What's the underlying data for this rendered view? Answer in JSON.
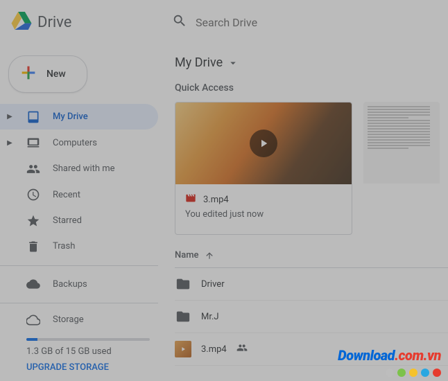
{
  "header": {
    "product_name": "Drive",
    "search_placeholder": "Search Drive"
  },
  "new_button": {
    "label": "New"
  },
  "nav": {
    "my_drive": "My Drive",
    "computers": "Computers",
    "shared": "Shared with me",
    "recent": "Recent",
    "starred": "Starred",
    "trash": "Trash",
    "backups": "Backups",
    "storage": "Storage"
  },
  "storage": {
    "used_text": "1.3 GB of 15 GB used",
    "upgrade": "UPGRADE STORAGE"
  },
  "main": {
    "breadcrumb": "My Drive",
    "quick_access_label": "Quick Access",
    "list_header_name": "Name"
  },
  "quick_access": {
    "primary": {
      "title": "3.mp4",
      "subtitle": "You edited just now"
    }
  },
  "files": [
    {
      "name": "Driver",
      "type": "folder"
    },
    {
      "name": "Mr.J",
      "type": "folder"
    },
    {
      "name": "3.mp4",
      "type": "video",
      "shared": true
    }
  ],
  "watermark": {
    "brand": "Download",
    "tld": ".com.vn",
    "dot_colors": [
      "#bdbdbd",
      "#7cc24a",
      "#f5c22b",
      "#29a7e1",
      "#e63b2e"
    ]
  }
}
